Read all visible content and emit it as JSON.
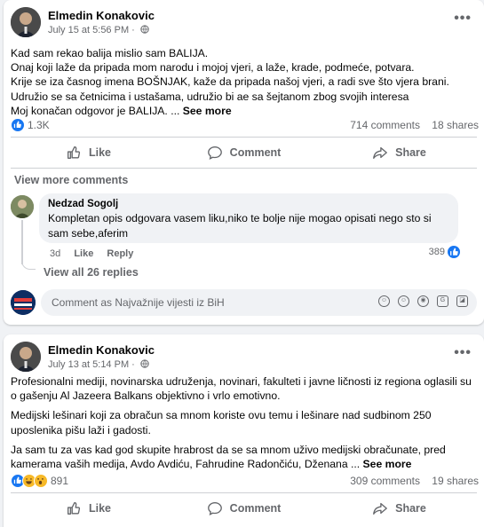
{
  "post1": {
    "author": "Elmedin Konakovic",
    "date": "July 15 at 5:56 PM",
    "dot": "·",
    "more": "•••",
    "lines": [
      "Kad sam rekao balija mislio sam BALIJA.",
      "Onaj koji laže da pripada mom narodu i mojoj vjeri, a laže, krade, podmeće, potvara.",
      "Krije se iza časnog imena BOŠNJAK, kaže da pripada našoj vjeri, a radi sve što vjera brani.",
      "Udružio se sa četnicima i ustašama, udružio bi ae sa šejtanom zbog svojih interesa",
      "Moj konačan odgovor je BALIJA. ..."
    ],
    "see_more": "See more",
    "reactions": "1.3K",
    "comments": "714 comments",
    "shares": "18 shares",
    "like_label": "Like",
    "comment_label": "Comment",
    "share_label": "Share",
    "view_more_comments": "View more comments",
    "comment": {
      "author": "Nedzad Sogolj",
      "text": "Kompletan opis odgovara vasem liku,niko te bolje nije mogao opisati nego sto si sam sebe,aferim",
      "age": "3d",
      "like": "Like",
      "reply": "Reply",
      "reaction_count": "389"
    },
    "view_all_replies": "View all 26 replies",
    "comment_placeholder": "Comment as Najvažnije vijesti iz BiH"
  },
  "post2": {
    "author": "Elmedin Konakovic",
    "date": "July 13 at 5:14 PM",
    "dot": "·",
    "more": "•••",
    "paragraphs": [
      "Profesionalni mediji, novinarska udruženja, novinari, fakulteti  i javne ličnosti iz regiona oglasili su o gašenju Al Jazeera Balkans objektivno i vrlo emotivno.",
      "Medijski lešinari koji za obračun sa mnom koriste ovu temu i lešinare nad sudbinom 250 uposlenika pišu laži i gadosti.",
      "Ja sam tu za vas kad god skupite hrabrost da se sa mnom uživo medijski obračunate, pred kamerama vaših medija, Avdo Avdiću, Fahrudine Radončiću, Dženana ..."
    ],
    "see_more": "See more",
    "reactions": "891",
    "comments": "309 comments",
    "shares": "19 shares",
    "like_label": "Like",
    "comment_label": "Comment",
    "share_label": "Share"
  },
  "colors": {
    "accent": "#1877f2",
    "secondary_text": "#65676b",
    "divider": "#ced0d4",
    "background": "#f0f2f5"
  }
}
